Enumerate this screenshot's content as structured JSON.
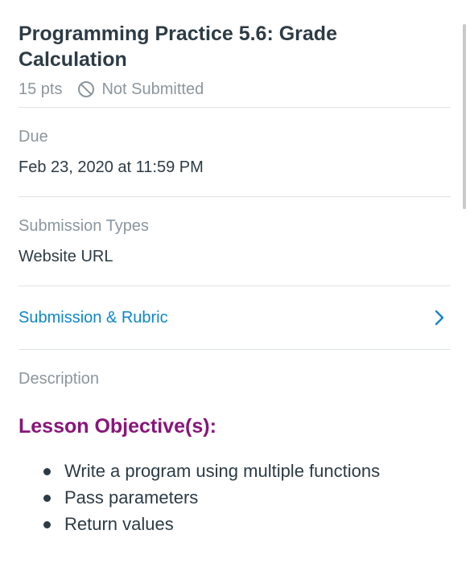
{
  "assignment": {
    "title": "Programming Practice 5.6: Grade Calculation",
    "points": "15 pts",
    "status": "Not Submitted",
    "status_icon": "not-submitted-icon"
  },
  "due": {
    "label": "Due",
    "value": "Feb 23, 2020 at 11:59 PM"
  },
  "submission_types": {
    "label": "Submission Types",
    "value": "Website URL"
  },
  "submission_link": {
    "label": "Submission & Rubric",
    "icon": "chevron-right-icon"
  },
  "description": {
    "label": "Description",
    "heading": "Lesson Objective(s):",
    "objectives": [
      "Write a program using multiple functions",
      "Pass parameters",
      "Return values"
    ]
  },
  "colors": {
    "link": "#0e87c9",
    "heading": "#88157a",
    "muted": "#8b969e",
    "text": "#2d3b45",
    "divider": "#dfe3e6"
  }
}
